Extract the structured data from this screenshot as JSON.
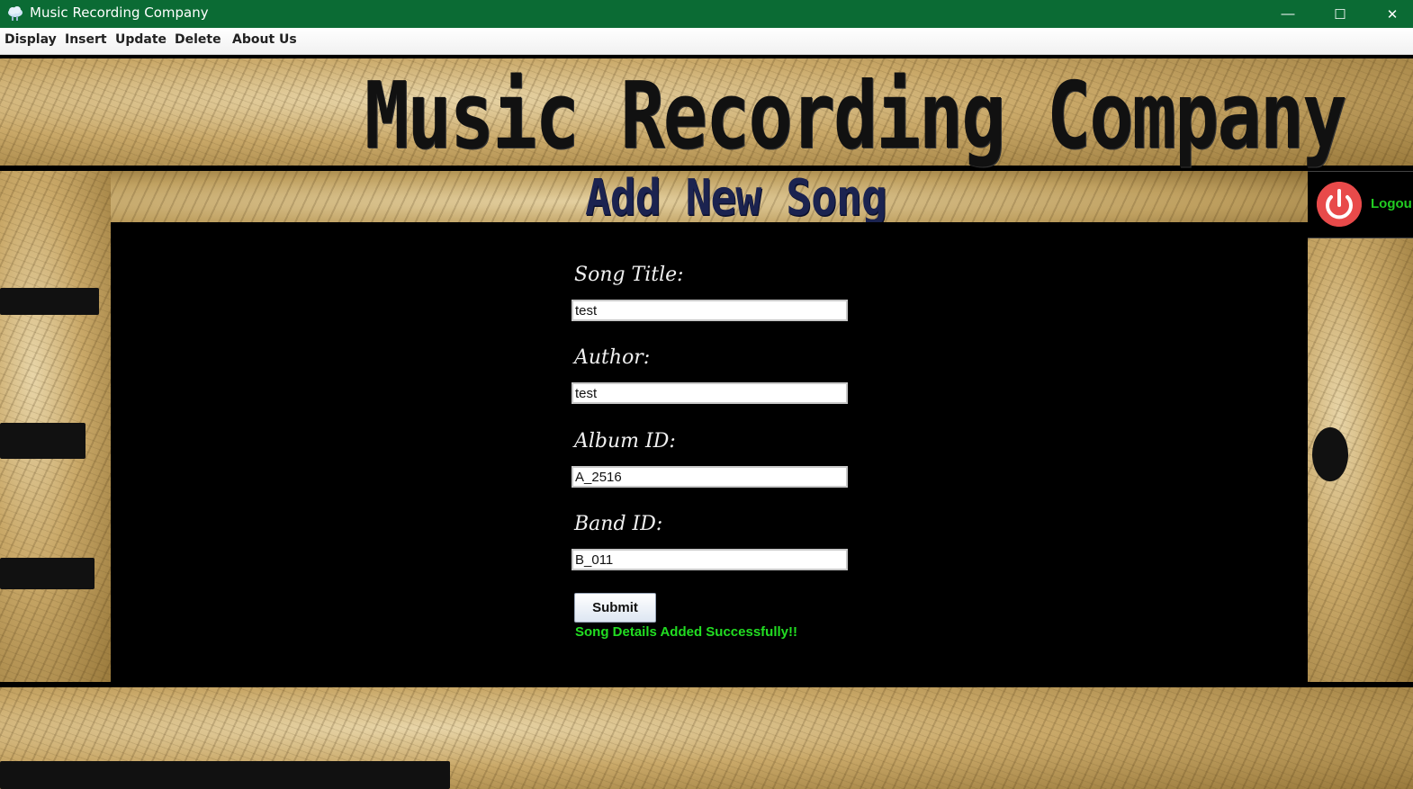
{
  "window": {
    "title": "Music Recording Company",
    "minimize_glyph": "—",
    "maximize_glyph": "☐",
    "close_glyph": "✕"
  },
  "menu": {
    "items": [
      "Display",
      "Insert",
      "Update",
      "Delete",
      "About Us"
    ]
  },
  "header": {
    "app_title": "Music Recording Company",
    "page_title": "Add New Song"
  },
  "form": {
    "song_title_label": "Song Title:",
    "song_title_value": "test",
    "author_label": "Author:",
    "author_value": "test",
    "album_id_label": "Album ID:",
    "album_id_value": "A_2516",
    "band_id_label": "Band ID:",
    "band_id_value": "B_011",
    "submit_label": "Submit",
    "status_message": "Song Details Added Successfully!!"
  },
  "logout": {
    "label": "Logou",
    "icon": "power-icon"
  },
  "colors": {
    "titlebar": "#0b6b34",
    "success": "#22dd22",
    "power_button": "#e84a4a",
    "page_title": "#1b2350"
  }
}
